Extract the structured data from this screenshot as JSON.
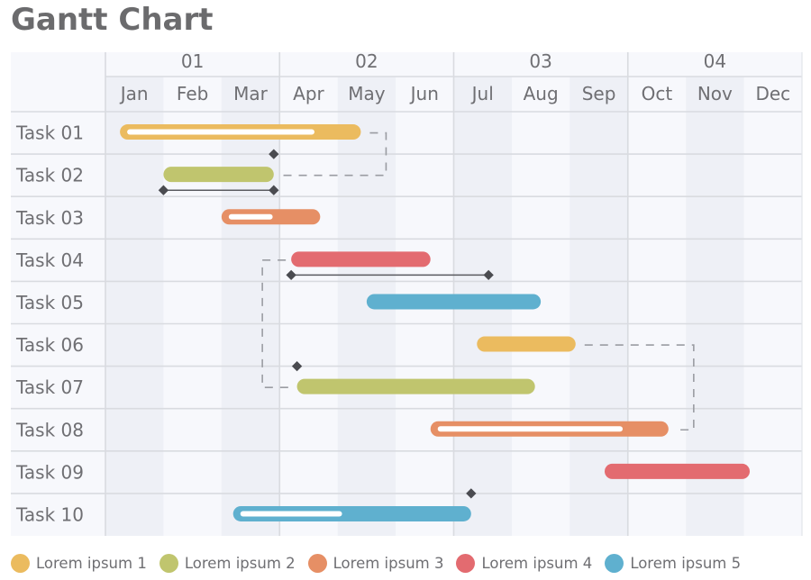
{
  "chart_data": {
    "type": "gantt",
    "title": "Gantt Chart",
    "quarters": [
      "01",
      "02",
      "03",
      "04"
    ],
    "months": [
      "Jan",
      "Feb",
      "Mar",
      "Apr",
      "May",
      "Jun",
      "Jul",
      "Aug",
      "Sep",
      "Oct",
      "Nov",
      "Dec"
    ],
    "x_unit": "months from start of Jan",
    "xlim": [
      0,
      12
    ],
    "tasks": [
      {
        "label": "Task 01",
        "start": 0.25,
        "end": 4.4,
        "series": 0,
        "progress": 0.8
      },
      {
        "label": "Task 02",
        "start": 1.0,
        "end": 2.9,
        "series": 1,
        "milestone_span": [
          1.0,
          2.9
        ]
      },
      {
        "label": "Task 03",
        "start": 2.0,
        "end": 3.7,
        "series": 2,
        "progress": 0.5
      },
      {
        "label": "Task 04",
        "start": 3.2,
        "end": 5.6,
        "series": 3,
        "milestone_span": [
          3.2,
          6.6
        ]
      },
      {
        "label": "Task 05",
        "start": 4.5,
        "end": 7.5,
        "series": 4
      },
      {
        "label": "Task 06",
        "start": 6.4,
        "end": 8.1,
        "series": 0
      },
      {
        "label": "Task 07",
        "start": 3.3,
        "end": 7.4,
        "series": 1
      },
      {
        "label": "Task 08",
        "start": 5.6,
        "end": 9.7,
        "series": 2,
        "progress": 0.8
      },
      {
        "label": "Task 09",
        "start": 8.6,
        "end": 11.1,
        "series": 3
      },
      {
        "label": "Task 10",
        "start": 2.2,
        "end": 6.3,
        "series": 4,
        "progress": 0.45
      }
    ],
    "milestones": [
      {
        "task_index": 1,
        "position": "top",
        "at": 2.9
      },
      {
        "task_index": 6,
        "position": "top",
        "at": 3.3
      },
      {
        "task_index": 9,
        "position": "top",
        "at": 6.3
      }
    ],
    "dependencies": [
      {
        "from": 0,
        "to": 1,
        "route": "end-to-end"
      },
      {
        "from": 3,
        "to": 6,
        "route": "start-to-start"
      },
      {
        "from": 5,
        "to": 7,
        "route": "end-to-end"
      }
    ],
    "legend": [
      {
        "label": "Lorem ipsum 1",
        "color": "#ebbb5f"
      },
      {
        "label": "Lorem ipsum 2",
        "color": "#c0c56e"
      },
      {
        "label": "Lorem ipsum 3",
        "color": "#e68f65"
      },
      {
        "label": "Lorem ipsum 4",
        "color": "#e36b70"
      },
      {
        "label": "Lorem ipsum 5",
        "color": "#5fb0cf"
      }
    ],
    "legend_position": "bottom"
  }
}
